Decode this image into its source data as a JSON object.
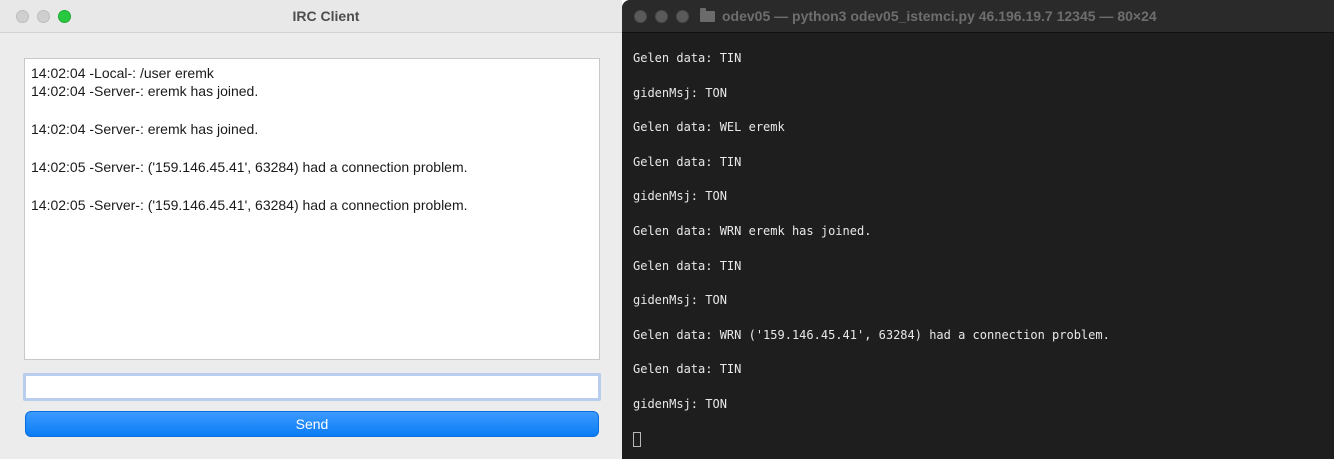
{
  "irc": {
    "title": "IRC Client",
    "messages": [
      "14:02:04 -Local-: /user eremk",
      "14:02:04 -Server-: eremk has joined.",
      "14:02:04 -Server-: eremk has joined.",
      "14:02:05 -Server-: ('159.146.45.41', 63284) had a connection problem.",
      "14:02:05 -Server-: ('159.146.45.41', 63284) had a connection problem."
    ],
    "input_value": "",
    "send_label": "Send"
  },
  "terminal": {
    "title": "odev05 — python3 odev05_istemci.py 46.196.19.7 12345 — 80×24",
    "lines": [
      "Gelen data: TIN",
      "gidenMsj: TON",
      "Gelen data: WEL eremk",
      "Gelen data: TIN",
      "gidenMsj: TON",
      "Gelen data: WRN eremk has joined.",
      "Gelen data: TIN",
      "gidenMsj: TON",
      "Gelen data: WRN ('159.146.45.41', 63284) had a connection problem.",
      "Gelen data: TIN",
      "gidenMsj: TON"
    ]
  },
  "colors": {
    "send_button": "#0a7cf5",
    "terminal_bg": "#1e1e1e",
    "traffic_green": "#28c840"
  }
}
